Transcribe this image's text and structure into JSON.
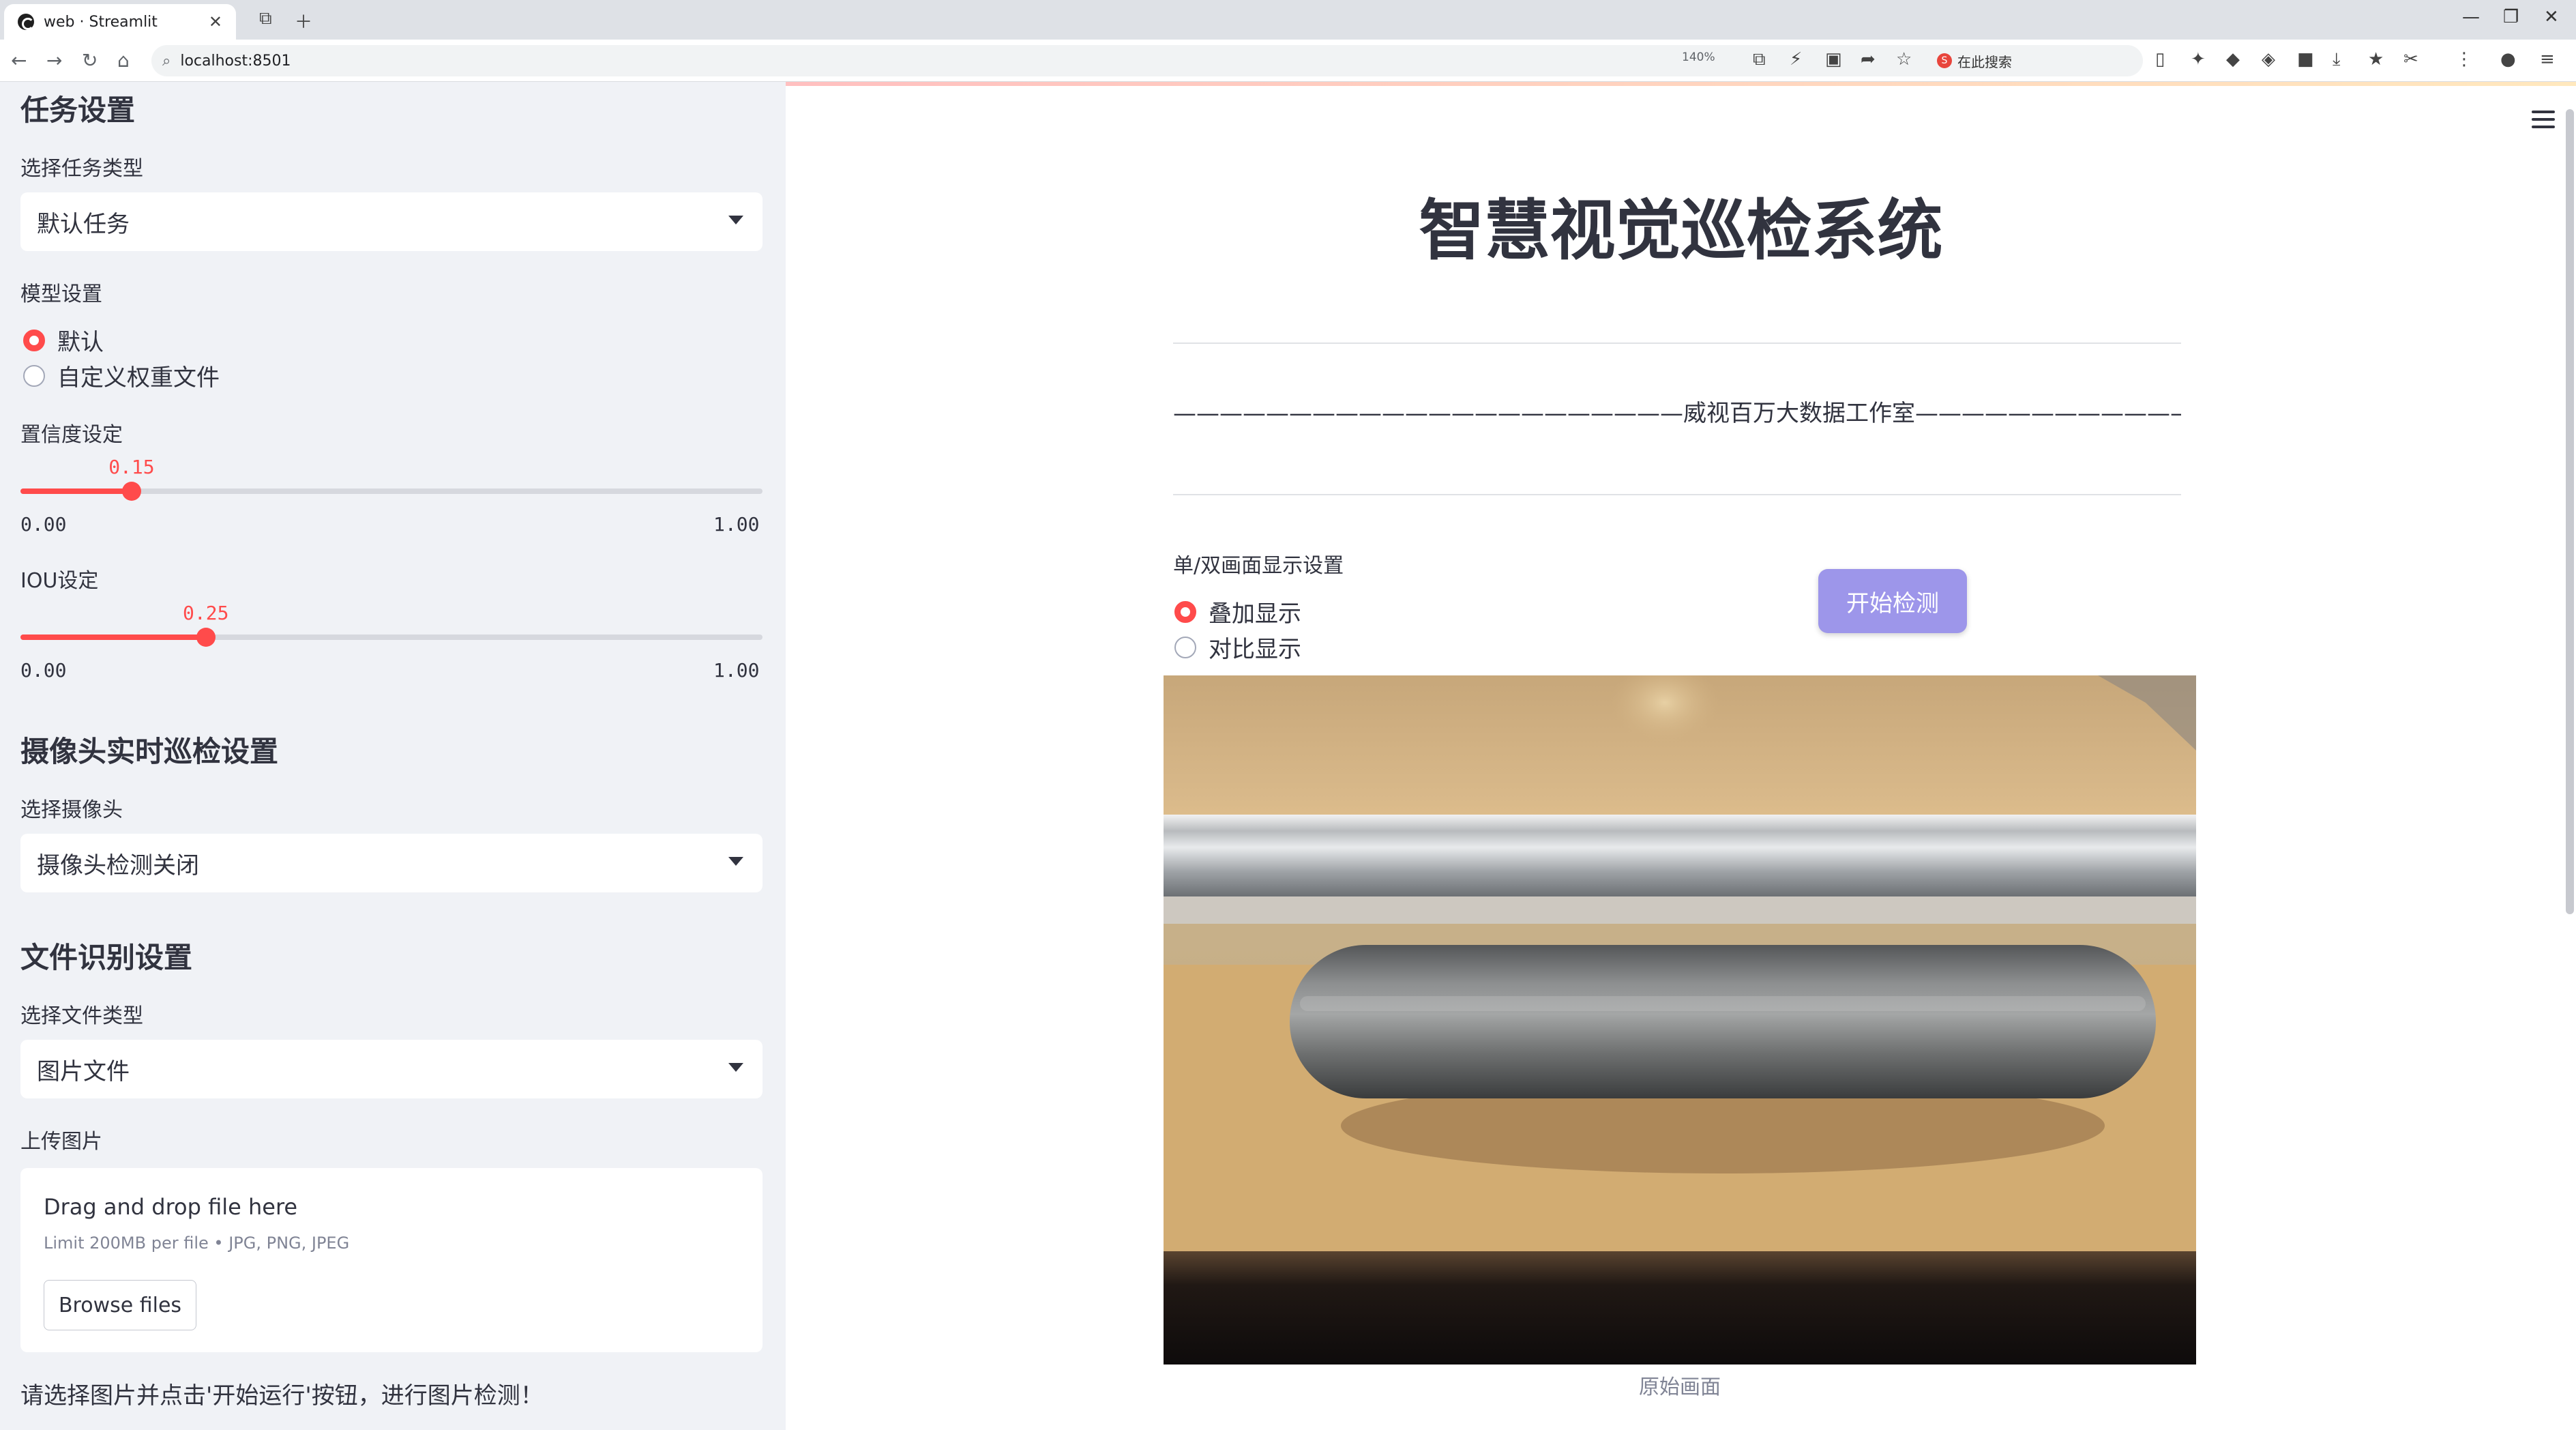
{
  "browser": {
    "tab_title": "web · Streamlit",
    "url": "localhost:8501",
    "zoom": "140%",
    "search_label": "在此搜索"
  },
  "sidebar": {
    "task_heading": "任务设置",
    "task_type_label": "选择任务类型",
    "task_type_value": "默认任务",
    "model_label": "模型设置",
    "model_options": [
      "默认",
      "自定义权重文件"
    ],
    "model_selected": 0,
    "conf_label": "置信度设定",
    "conf": {
      "value": 0.15,
      "display": "0.15",
      "min": "0.00",
      "max": "1.00"
    },
    "iou_label": "IOU设定",
    "iou": {
      "value": 0.25,
      "display": "0.25",
      "min": "0.00",
      "max": "1.00"
    },
    "camera_heading": "摄像头实时巡检设置",
    "camera_label": "选择摄像头",
    "camera_value": "摄像头检测关闭",
    "file_heading": "文件识别设置",
    "file_type_label": "选择文件类型",
    "file_type_value": "图片文件",
    "upload_label": "上传图片",
    "upload_title": "Drag and drop file here",
    "upload_limit": "Limit 200MB per file • JPG, PNG, JPEG",
    "browse_label": "Browse files",
    "note": "请选择图片并点击'开始运行'按钮，进行图片检测！"
  },
  "main": {
    "title": "智慧视觉巡检系统",
    "studio_line": "——————————————————————威视百万大数据工作室———————————————————————",
    "display_label": "单/双画面显示设置",
    "display_options": [
      "叠加显示",
      "对比显示"
    ],
    "display_selected": 0,
    "start_button": "开始检测",
    "image_caption": "原始画面"
  },
  "colors": {
    "accent": "#ff4b4b",
    "button": "#9d96ea",
    "sidebar_bg": "#f0f2f6"
  }
}
